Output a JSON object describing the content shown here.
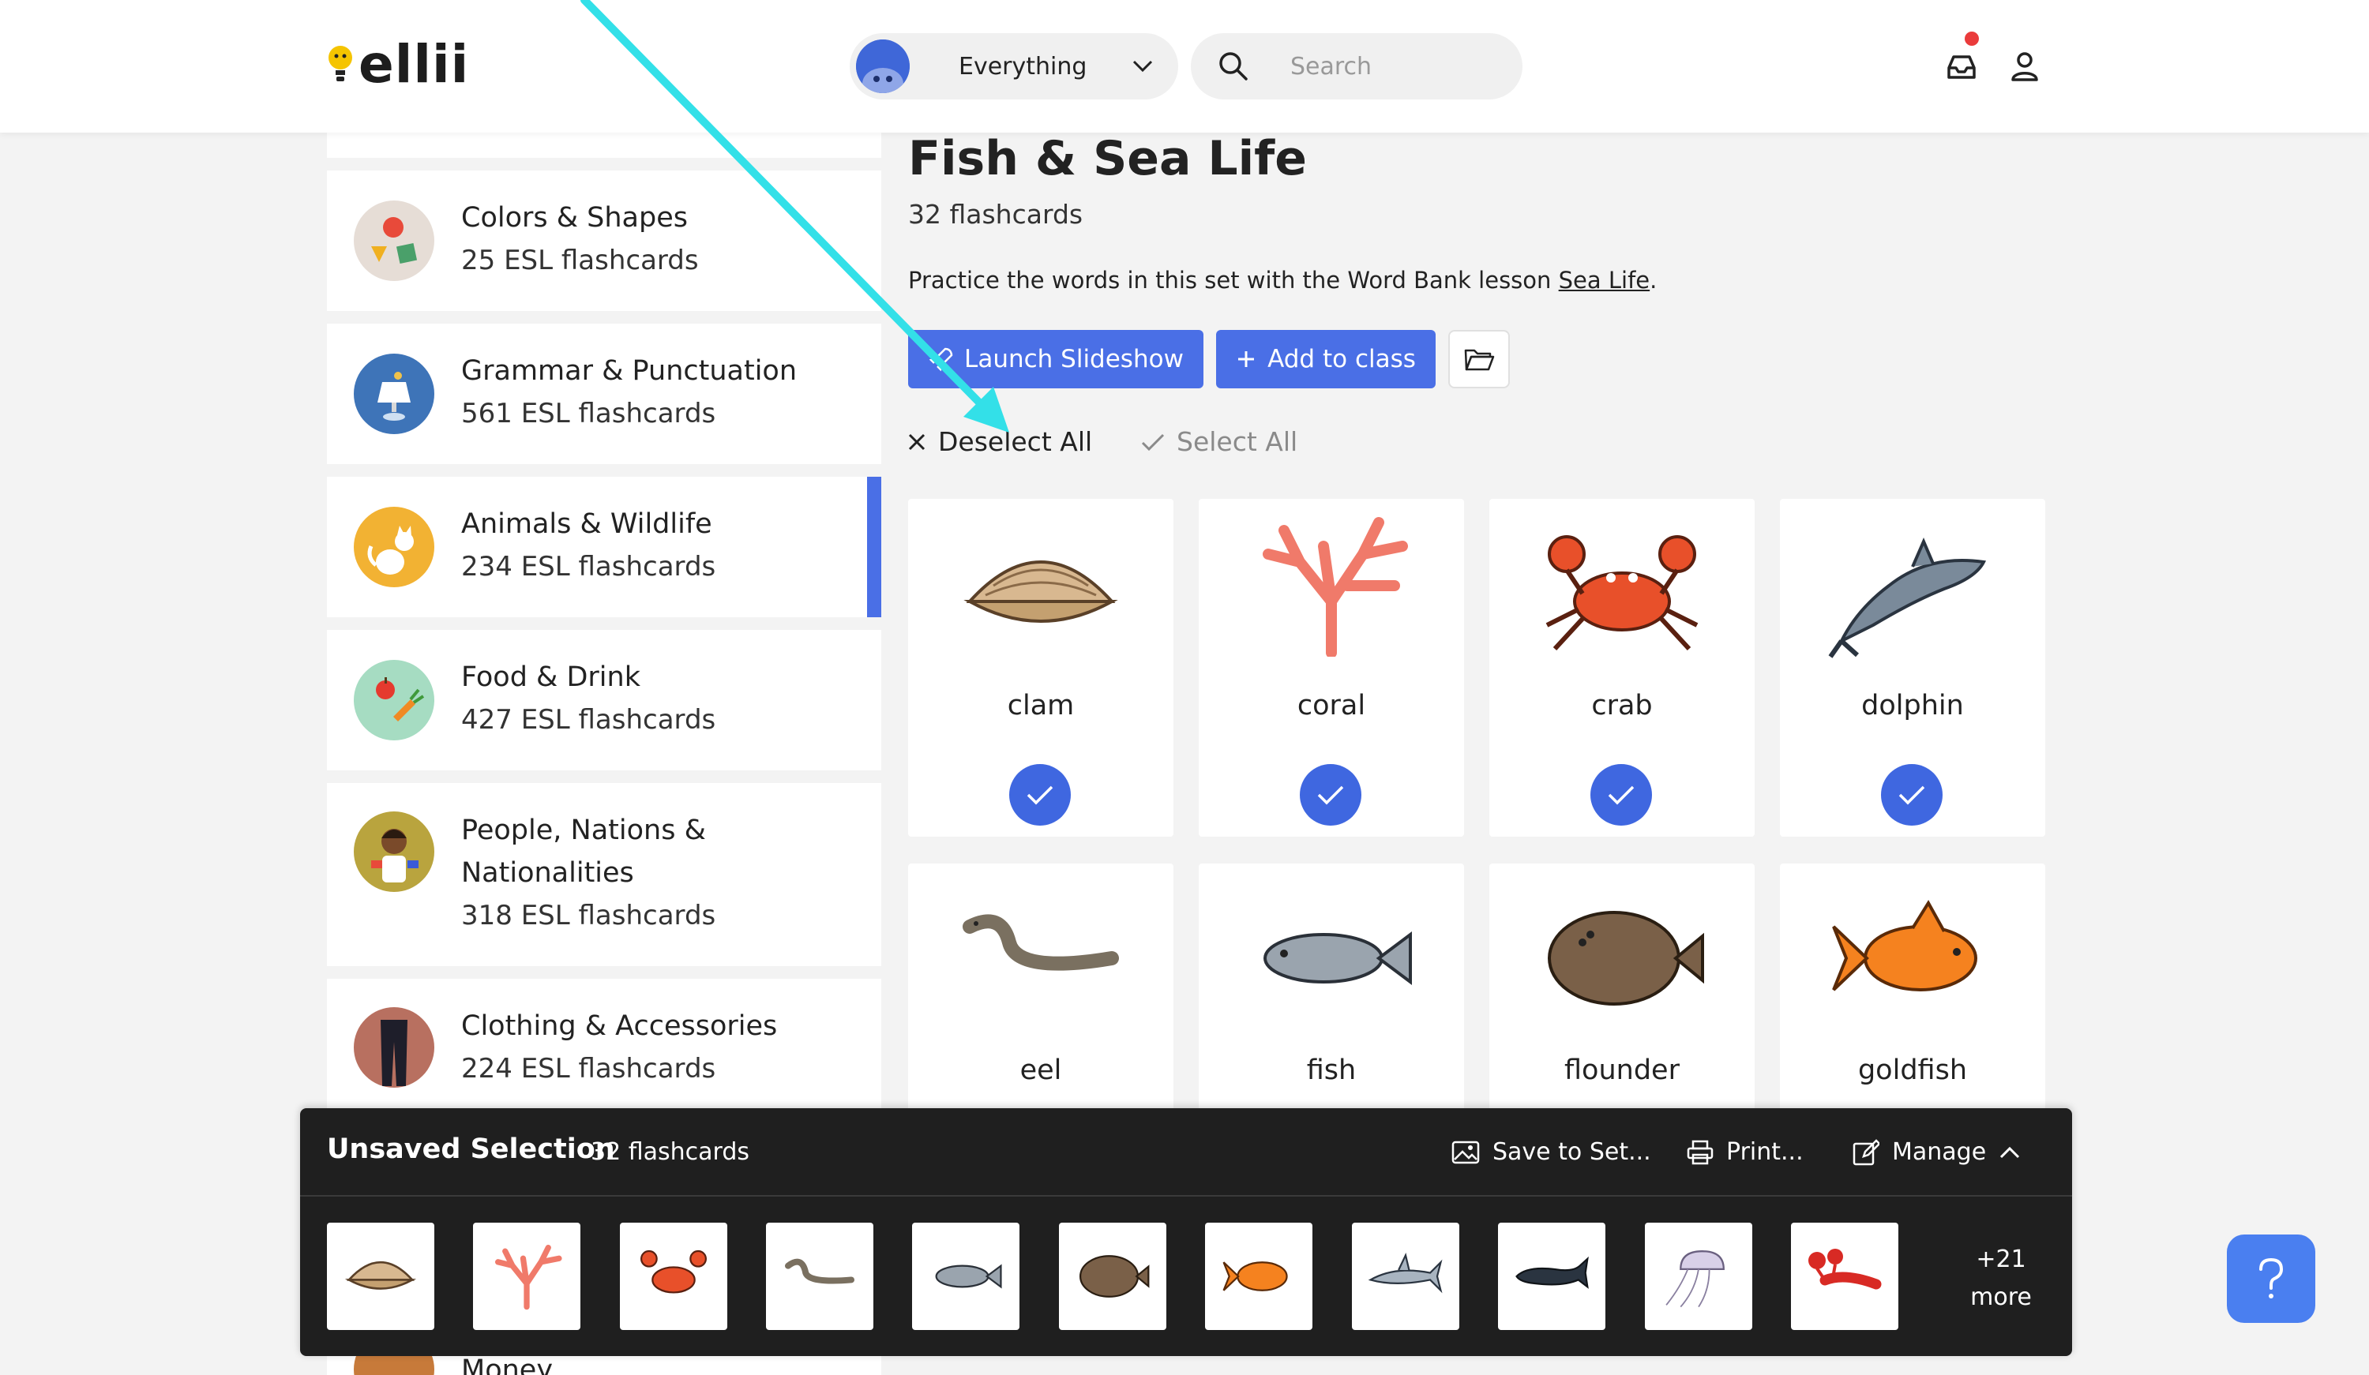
{
  "header": {
    "logo_text": "ellii",
    "filter_label": "Everything",
    "search_placeholder": "Search"
  },
  "sidebar": {
    "categories": [
      {
        "title": "Colors & Shapes",
        "count": "25 ESL flashcards",
        "icon": "shapes-icon"
      },
      {
        "title": "Grammar & Punctuation",
        "count": "561 ESL flashcards",
        "icon": "lamp-icon"
      },
      {
        "title": "Animals & Wildlife",
        "count": "234 ESL flashcards",
        "icon": "cat-icon",
        "active": true
      },
      {
        "title": "Food & Drink",
        "count": "427 ESL flashcards",
        "icon": "fruit-icon"
      },
      {
        "title_line1": "People, Nations &",
        "title_line2": "Nationalities",
        "count": "318 ESL flashcards",
        "icon": "person-icon"
      },
      {
        "title": "Clothing & Accessories",
        "count": "224 ESL flashcards",
        "icon": "pants-icon"
      },
      {
        "title": "Money",
        "icon": "money-icon"
      }
    ]
  },
  "main": {
    "title": "Fish & Sea Life",
    "count": "32 flashcards",
    "desc_prefix": "Practice the words in this set with the Word Bank lesson ",
    "desc_link": "Sea Life",
    "desc_suffix": ".",
    "launch_label": "Launch Slideshow",
    "add_label": "Add to class",
    "deselect_label": "Deselect All",
    "select_label": "Select All",
    "cards": [
      {
        "word": "clam",
        "selected": true
      },
      {
        "word": "coral",
        "selected": true
      },
      {
        "word": "crab",
        "selected": true
      },
      {
        "word": "dolphin",
        "selected": true
      },
      {
        "word": "eel"
      },
      {
        "word": "fish"
      },
      {
        "word": "flounder"
      },
      {
        "word": "goldfish"
      }
    ]
  },
  "selection_bar": {
    "title": "Unsaved Selection",
    "count": "32 flashcards",
    "save_label": "Save to Set...",
    "print_label": "Print...",
    "manage_label": "Manage",
    "more_count": "+21",
    "more_label": "more",
    "thumbnails": [
      "clam",
      "coral",
      "crab",
      "eel",
      "fish",
      "flounder",
      "goldfish",
      "shark",
      "whale",
      "jellyfish",
      "lobster"
    ]
  },
  "colors": {
    "accent": "#4a6fe6",
    "bar_bg": "#1f1f1f",
    "annotation": "#33e0e8",
    "notification": "#ea3b3b"
  }
}
